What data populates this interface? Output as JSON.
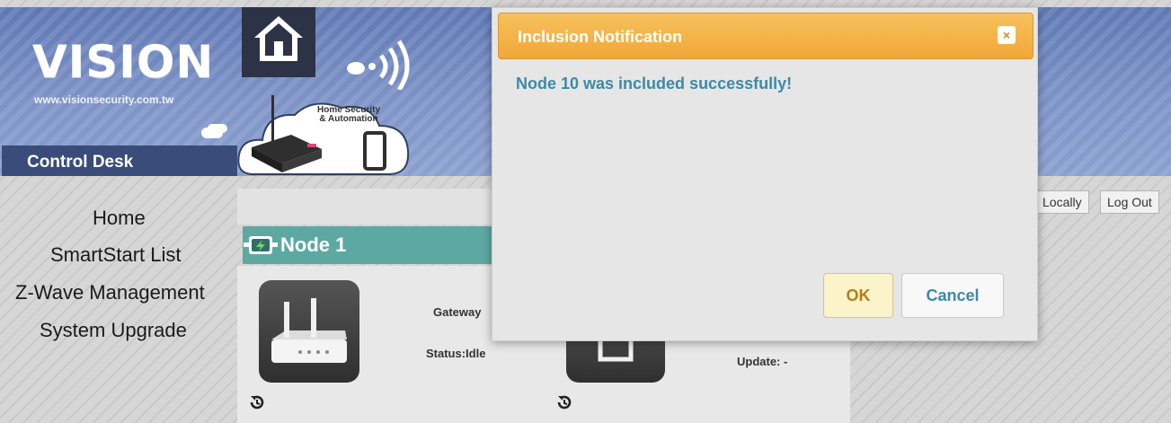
{
  "brand": {
    "logo_text": "VISION",
    "url": "www.visionsecurity.com.tw",
    "section": "Control Desk",
    "tagline_line1": "Home Security",
    "tagline_line2": "& Automation"
  },
  "nav": {
    "items": [
      {
        "label": "Home"
      },
      {
        "label": "SmartStart List"
      },
      {
        "label": "Z-Wave Management"
      },
      {
        "label": "System Upgrade"
      }
    ]
  },
  "toolbar": {
    "locally_label": "Locally",
    "logout_label": "Log Out"
  },
  "node": {
    "title": "Node 1",
    "gateway_label": "Gateway",
    "status_label": "Status:Idle",
    "update_label": "Update: -"
  },
  "modal": {
    "title": "Inclusion Notification",
    "close_glyph": "×",
    "message": "Node 10 was included successfully!",
    "ok_label": "OK",
    "cancel_label": "Cancel"
  },
  "colors": {
    "header_blue": "#7d93c7",
    "control_desk_bg": "#3a4c79",
    "node_header_teal": "#5ea8a2",
    "modal_header_orange": "#f1a739",
    "message_teal": "#3c8aa5"
  },
  "icons": [
    "home-icon",
    "wifi-icon",
    "router-icon",
    "phone-icon",
    "power-icon",
    "history-icon",
    "close-icon"
  ]
}
